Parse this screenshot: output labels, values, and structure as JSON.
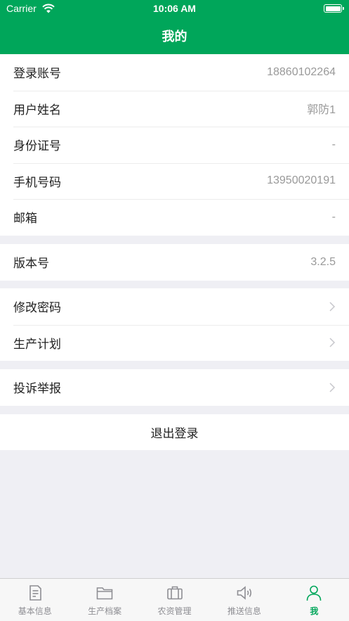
{
  "status_bar": {
    "carrier": "Carrier",
    "time": "10:06 AM"
  },
  "nav": {
    "title": "我的"
  },
  "profile": [
    {
      "label": "登录账号",
      "value": "18860102264"
    },
    {
      "label": "用户姓名",
      "value": "郭防1"
    },
    {
      "label": "身份证号",
      "value": "-"
    },
    {
      "label": "手机号码",
      "value": "13950020191"
    },
    {
      "label": "邮箱",
      "value": "-"
    }
  ],
  "version": {
    "label": "版本号",
    "value": "3.2.5"
  },
  "settings": [
    {
      "label": "修改密码"
    },
    {
      "label": "生产计划"
    }
  ],
  "report": {
    "label": "投诉举报"
  },
  "logout_label": "退出登录",
  "tabs": [
    {
      "label": "基本信息",
      "icon": "document-icon"
    },
    {
      "label": "生产档案",
      "icon": "folder-icon"
    },
    {
      "label": "农资管理",
      "icon": "briefcase-icon"
    },
    {
      "label": "推送信息",
      "icon": "speaker-icon"
    },
    {
      "label": "我",
      "icon": "person-icon",
      "active": true
    }
  ],
  "colors": {
    "accent": "#00a65a",
    "background": "#efeff4",
    "inactive": "#8e8e93"
  }
}
